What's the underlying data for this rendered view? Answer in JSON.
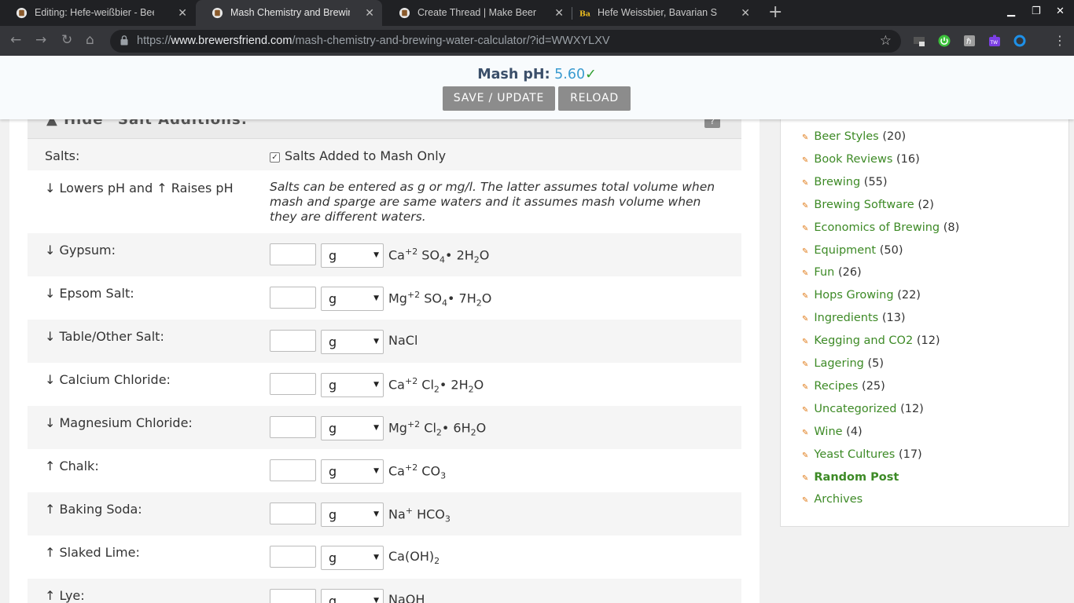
{
  "tabs": [
    {
      "title": "Editing: Hefe-weißbier - Beer Recipe",
      "active": false
    },
    {
      "title": "Mash Chemistry and Brewing Water Calculator",
      "active": true
    },
    {
      "title": "Create Thread | Make Beer at Home",
      "active": false
    },
    {
      "title": "Hefe Weissbier, Bavarian Style | BeerAdvocate",
      "active": false
    }
  ],
  "address_bar": {
    "scheme": "https://",
    "domain": "www.brewersfriend.com",
    "path": "/mash-chemistry-and-brewing-water-calculator/?id=WWXYLXV"
  },
  "ph_header": {
    "label": "Mash pH:",
    "value": "5.60",
    "status_glyph": "✓",
    "save_label": "SAVE / UPDATE",
    "reload_label": "RELOAD"
  },
  "section": {
    "toggle_label": "▲ Hide",
    "title": "Salt Additions:",
    "help": "?"
  },
  "salts_row": {
    "label": "Salts:",
    "checkbox_label": "Salts Added to Mash Only",
    "checked": true
  },
  "info_row": {
    "label": "↓ Lowers pH and ↑ Raises pH",
    "note": "Salts can be entered as g or mg/l. The latter assumes total volume when mash and sparge are same waters and it assumes mash volume when they are different waters."
  },
  "salt_rows": [
    {
      "label": "↓ Gypsum:",
      "value": "",
      "unit": "g",
      "formula": {
        "a": "Ca",
        "a_sup": "+2",
        "b": " SO",
        "b_sub": "4",
        "c": "• 2H",
        "c_sub": "2",
        "d": "O"
      }
    },
    {
      "label": "↓ Epsom Salt:",
      "value": "",
      "unit": "g",
      "formula": {
        "a": "Mg",
        "a_sup": "+2",
        "b": " SO",
        "b_sub": "4",
        "c": "• 7H",
        "c_sub": "2",
        "d": "O"
      }
    },
    {
      "label": "↓ Table/Other Salt:",
      "value": "",
      "unit": "g",
      "formula": {
        "a": "NaCl",
        "a_sup": "",
        "b": "",
        "b_sub": "",
        "c": "",
        "c_sub": "",
        "d": ""
      }
    },
    {
      "label": "↓ Calcium Chloride:",
      "value": "",
      "unit": "g",
      "formula": {
        "a": "Ca",
        "a_sup": "+2",
        "b": " Cl",
        "b_sub": "2",
        "c": "• 2H",
        "c_sub": "2",
        "d": "O"
      }
    },
    {
      "label": "↓ Magnesium Chloride:",
      "value": "",
      "unit": "g",
      "formula": {
        "a": "Mg",
        "a_sup": "+2",
        "b": " Cl",
        "b_sub": "2",
        "c": "• 6H",
        "c_sub": "2",
        "d": "O"
      }
    },
    {
      "label": "↑ Chalk:",
      "value": "",
      "unit": "g",
      "formula": {
        "a": "Ca",
        "a_sup": "+2",
        "b": " CO",
        "b_sub": "3",
        "c": "",
        "c_sub": "",
        "d": ""
      }
    },
    {
      "label": "↑ Baking Soda:",
      "value": "",
      "unit": "g",
      "formula": {
        "a": "Na",
        "a_sup": "+",
        "b": " HCO",
        "b_sub": "3",
        "c": "",
        "c_sub": "",
        "d": ""
      }
    },
    {
      "label": "↑ Slaked Lime:",
      "value": "",
      "unit": "g",
      "formula": {
        "a": "Ca(OH)",
        "a_sup": "",
        "b": "",
        "b_sub": "2",
        "c": "",
        "c_sub": "",
        "d": ""
      }
    },
    {
      "label": "↑ Lye:",
      "value": "",
      "unit": "g",
      "formula": {
        "a": "NaOH",
        "a_sup": "",
        "b": "",
        "b_sub": "",
        "c": "",
        "c_sub": "",
        "d": ""
      }
    }
  ],
  "sidebar": {
    "categories": [
      {
        "name": "Beer Styles",
        "count": "(20)"
      },
      {
        "name": "Book Reviews",
        "count": "(16)"
      },
      {
        "name": "Brewing",
        "count": "(55)"
      },
      {
        "name": "Brewing Software",
        "count": "(2)"
      },
      {
        "name": "Economics of Brewing",
        "count": "(8)"
      },
      {
        "name": "Equipment",
        "count": "(50)"
      },
      {
        "name": "Fun",
        "count": "(26)"
      },
      {
        "name": "Hops Growing",
        "count": "(22)"
      },
      {
        "name": "Ingredients",
        "count": "(13)"
      },
      {
        "name": "Kegging and CO2",
        "count": "(12)"
      },
      {
        "name": "Lagering",
        "count": "(5)"
      },
      {
        "name": "Recipes",
        "count": "(25)"
      },
      {
        "name": "Uncategorized",
        "count": "(12)"
      },
      {
        "name": "Wine",
        "count": "(4)"
      },
      {
        "name": "Yeast Cultures",
        "count": "(17)"
      },
      {
        "name": "Random Post",
        "count": ""
      },
      {
        "name": "Archives",
        "count": ""
      }
    ]
  },
  "colors": {
    "link": "#3d8a26",
    "ph_value": "#3a9bd0",
    "ok": "#2e9e2e",
    "button": "#8c8c8c",
    "bullet": "#e07c1a"
  }
}
